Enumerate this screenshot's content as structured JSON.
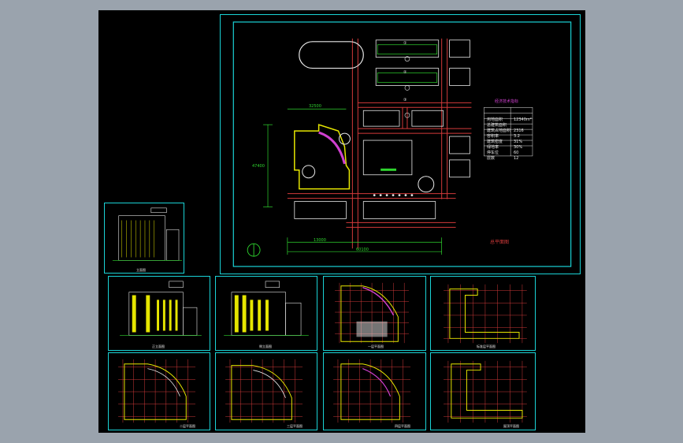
{
  "app": {
    "view": "model-space",
    "colors": {
      "workspace_bg": "#9aa3ad",
      "canvas_bg": "#000000",
      "sheet_border": "#1ad3d6",
      "wall_yellow": "#e6e600",
      "grid_red": "#d23a3a",
      "dim_green": "#2fd62f",
      "accent_magenta": "#d040d0",
      "line_white": "#e8e8e8"
    }
  },
  "sheets": {
    "site_plan": {
      "road_labels": [
        "①",
        "②",
        "③"
      ],
      "table": {
        "title": "经济技术指标",
        "rows": [
          {
            "k": "用地面积",
            "v": "12340m²"
          },
          {
            "k": "总建筑面积",
            "v": ""
          },
          {
            "k": "建筑占地面积",
            "v": "2316"
          },
          {
            "k": "容积率",
            "v": "3.2"
          },
          {
            "k": "建筑密度",
            "v": "31%"
          },
          {
            "k": "绿地率",
            "v": "30%"
          },
          {
            "k": "停车位",
            "v": "60"
          },
          {
            "k": "层数",
            "v": "12"
          }
        ]
      },
      "title_label": "总平面图",
      "dimensions": [
        "47400",
        "32500",
        "60100",
        "13000"
      ]
    },
    "thumbnails": [
      {
        "id": "elevation-1",
        "caption": "立面图"
      },
      {
        "id": "elevation-2",
        "caption": "正立面图"
      },
      {
        "id": "elevation-3",
        "caption": "侧立面图"
      },
      {
        "id": "plan-floor-1",
        "caption": "一层平面图"
      },
      {
        "id": "plan-standard",
        "caption": "标准层平面图"
      },
      {
        "id": "plan-floor-2",
        "caption": "二层平面图"
      },
      {
        "id": "plan-floor-3",
        "caption": "三层平面图"
      },
      {
        "id": "plan-floor-4",
        "caption": "四层平面图"
      },
      {
        "id": "plan-roof",
        "caption": "屋顶平面图"
      }
    ]
  }
}
